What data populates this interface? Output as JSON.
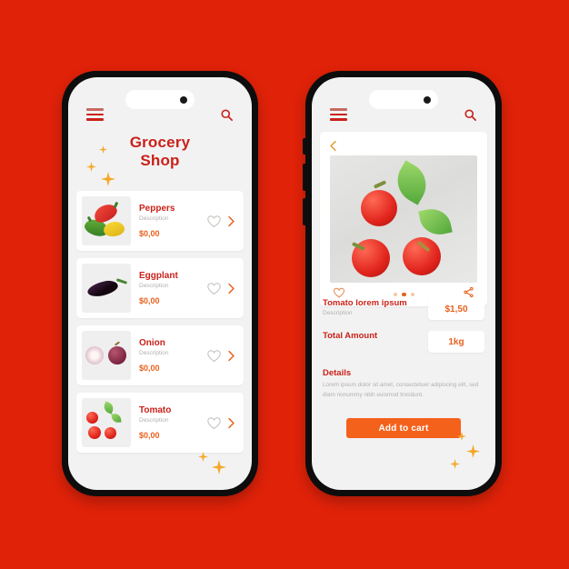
{
  "background_color": "#e02209",
  "brand": {
    "red": "#c9211a",
    "orange": "#e8601c",
    "button_orange": "#f4611b",
    "muted": "#b5b0ae",
    "gold": "#f4a92b"
  },
  "screen_left": {
    "appbar": {
      "menu_icon": "hamburger-menu-icon",
      "search_icon": "search-icon"
    },
    "title_line1": "Grocery",
    "title_line2": "Shop",
    "products": [
      {
        "name": "Peppers",
        "description": "Description",
        "price": "$0,00",
        "favorite_icon": "heart-icon",
        "chevron": "›"
      },
      {
        "name": "Eggplant",
        "description": "Description",
        "price": "$0,00",
        "favorite_icon": "heart-icon",
        "chevron": "›"
      },
      {
        "name": "Onion",
        "description": "Description",
        "price": "$0,00",
        "favorite_icon": "heart-icon",
        "chevron": "›"
      },
      {
        "name": "Tomato",
        "description": "Description",
        "price": "$0,00",
        "favorite_icon": "heart-icon",
        "chevron": "›"
      }
    ]
  },
  "screen_right": {
    "appbar": {
      "menu_icon": "hamburger-menu-icon",
      "search_icon": "search-icon"
    },
    "back_chevron": "‹",
    "gallery": {
      "favorite_icon": "heart-icon",
      "share_icon": "share-icon",
      "dots_total": 3,
      "active_dot_index": 1
    },
    "price_row": {
      "label": "Tomato lorem ipsum",
      "sublabel": "Description",
      "value": "$1,50"
    },
    "amount_row": {
      "label": "Total Amount",
      "value": "1kg"
    },
    "details_title": "Details",
    "details_body": "Lorem ipsum dolor sit amet, consectetuer adipiscing elit, sed diam nonummy nibh euismod tincidunt.",
    "cta_label": "Add to cart"
  }
}
